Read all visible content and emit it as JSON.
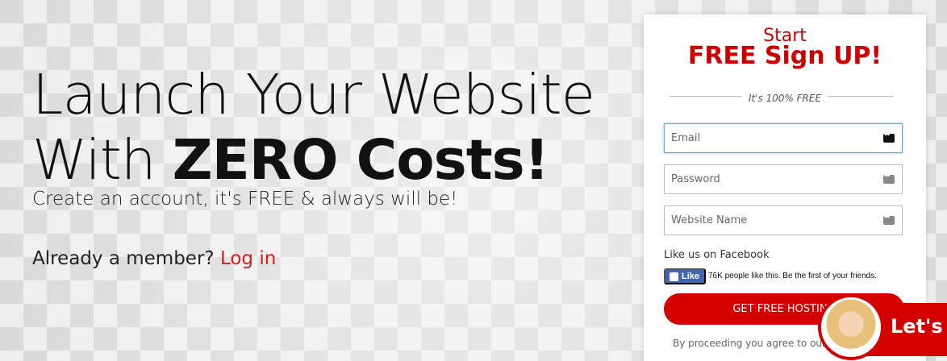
{
  "hero": {
    "headline_line1": "Launch Your Website",
    "headline_line2_prefix": "With ",
    "headline_line2_bold": "ZERO Costs",
    "headline_line2_suffix": "!",
    "subtitle": "Create an account, it's FREE & always will be!",
    "member_text": "Already a member?",
    "login_link": "Log in"
  },
  "signup": {
    "start": "Start",
    "title": "FREE Sign UP!",
    "divider_text": "It's 100% FREE",
    "email_placeholder": "Email",
    "password_placeholder": "Password",
    "website_placeholder": "Website Name",
    "facebook_label": "Like us on Facebook",
    "like_button": "Like",
    "like_count": "76K people like this. Be the first of your friends.",
    "submit_button": "GET FREE HOSTING",
    "terms_text": "By proceeding you agree to our"
  },
  "chat": {
    "label": "Let's"
  },
  "colors": {
    "accent": "#d40000",
    "link": "#d22020",
    "facebook": "#4267b2"
  }
}
